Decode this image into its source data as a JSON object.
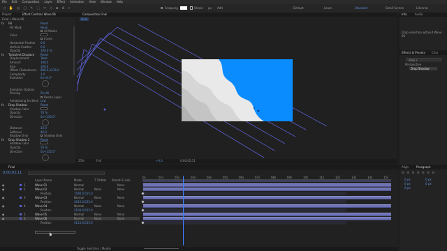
{
  "menu": [
    "File",
    "Edit",
    "Composition",
    "Layer",
    "Effect",
    "Animation",
    "View",
    "Window",
    "Help"
  ],
  "toolbar": {
    "snapping": "Snapping",
    "stroke_label": "Stroke",
    "px": "px",
    "add": "Add",
    "workspaces": [
      "Default",
      "Learn",
      "Standard",
      "Small Screen",
      "Libraries"
    ]
  },
  "project_tab": "Project",
  "effect_controls_tab": "Effect Controls Wave 06",
  "effect_subtitle": "Final • Wave 06",
  "effects": [
    {
      "type": "section",
      "label": "Fill",
      "right": "Reset"
    },
    {
      "type": "prop",
      "label": "Fill Mask",
      "value": "None"
    },
    {
      "type": "check",
      "label": "",
      "value": "All Masks"
    },
    {
      "type": "color",
      "label": "Color"
    },
    {
      "type": "check",
      "label": "",
      "value": "Invert"
    },
    {
      "type": "prop",
      "label": "Horizontal Feather",
      "value": "0.0"
    },
    {
      "type": "prop",
      "label": "Vertical Feather",
      "value": "0.0"
    },
    {
      "type": "prop",
      "label": "Opacity",
      "value": "100.0 %"
    },
    {
      "type": "section",
      "label": "Turbulent Displace",
      "right": "Reset"
    },
    {
      "type": "prop",
      "label": "Displacement",
      "value": "Twist"
    },
    {
      "type": "prop",
      "label": "Amount",
      "value": "100.0"
    },
    {
      "type": "prop",
      "label": "Size",
      "value": "100.0"
    },
    {
      "type": "prop",
      "label": "Offset (Turbulence)",
      "value": "896.0,1216.0"
    },
    {
      "type": "prop",
      "label": "Complexity",
      "value": "1.0"
    },
    {
      "type": "knob",
      "label": "Evolution",
      "value": "0x+0.0°"
    },
    {
      "type": "spacer"
    },
    {
      "type": "prop",
      "label": "Evolution Options",
      "value": ""
    },
    {
      "type": "prop",
      "label": "Pinning",
      "value": "Pin All"
    },
    {
      "type": "check",
      "label": "",
      "value": "Resize Layer"
    },
    {
      "type": "prop",
      "label": "Antialiasing for Best Qu",
      "value": "Low"
    },
    {
      "type": "section",
      "label": "Drop Shadow",
      "right": "Reset"
    },
    {
      "type": "color",
      "label": "Shadow Color"
    },
    {
      "type": "prop",
      "label": "Opacity",
      "value": "70 %"
    },
    {
      "type": "knob",
      "label": "Direction",
      "value": "0x+135.0°"
    },
    {
      "type": "spacer"
    },
    {
      "type": "prop",
      "label": "Distance",
      "value": "20.0"
    },
    {
      "type": "prop",
      "label": "Softness",
      "value": "40.0"
    },
    {
      "type": "check",
      "label": "Shadow Only",
      "value": "Shadow Only"
    },
    {
      "type": "section",
      "label": "Drop Shadow 2",
      "right": "Reset"
    },
    {
      "type": "color",
      "label": "Shadow Color"
    },
    {
      "type": "prop",
      "label": "Opacity",
      "value": "50 %"
    },
    {
      "type": "knob",
      "label": "Direction",
      "value": "0x+135.0°"
    }
  ],
  "comp": {
    "tab": "Composition Final",
    "chip": "Final",
    "zoom": "25%",
    "quality": "Full",
    "timecode": "0;00;02;11",
    "plus": "+0.0"
  },
  "info": {
    "tabs": [
      "Info",
      "Audio"
    ],
    "text": "Drop selection without Wave 06"
  },
  "effects_presets": {
    "title": "Effects & Presets",
    "tab2": "Char",
    "search": "drop s",
    "category": "Perspective",
    "item": "Drop Shadow"
  },
  "align": {
    "tab": "Align",
    "tab2": "Paragraph",
    "values": [
      "0 px",
      "0 px",
      "0 px",
      "0 px",
      "0 px"
    ]
  },
  "timeline": {
    "tab": "Final",
    "timecode": "0;00;02;11",
    "columns": [
      "Layer Name",
      "Mode",
      "T TrkMat",
      "Parent & Link"
    ],
    "ruler": [
      "0s",
      "01s",
      "02s",
      "03s",
      "04s",
      "05s",
      "06s",
      "07s",
      "08s",
      "09s",
      "10s",
      "11s",
      "12s",
      "13s",
      "14s",
      "15s"
    ],
    "footer": "Toggle Switches / Modes",
    "layers": [
      {
        "num": "1",
        "name": "Wave 01",
        "mode": "Normal",
        "trk": "",
        "parent": "None"
      },
      {
        "num": "2",
        "name": "Wave 02",
        "mode": "Normal",
        "trk": "None",
        "parent": "None"
      },
      {
        "num": "",
        "name": "Position",
        "mode": "1590.0,555.0",
        "trk": "",
        "parent": ""
      },
      {
        "num": "3",
        "name": "Wave 03",
        "mode": "Normal",
        "trk": "None",
        "parent": "None"
      },
      {
        "num": "",
        "name": "Position",
        "mode": "4015.0,555.0",
        "trk": "",
        "parent": ""
      },
      {
        "num": "4",
        "name": "Wave 04",
        "mode": "Normal",
        "trk": "None",
        "parent": "None"
      },
      {
        "num": "",
        "name": "Position",
        "mode": "2100.0,555.0",
        "trk": "",
        "parent": ""
      },
      {
        "num": "5",
        "name": "Wave 05",
        "mode": "Normal",
        "trk": "None",
        "parent": "None"
      },
      {
        "num": "6",
        "name": "Wave 06",
        "mode": "Normal",
        "trk": "None",
        "parent": "None"
      },
      {
        "num": "",
        "name": "Position",
        "mode": "4115.0,555.0",
        "trk": "",
        "parent": ""
      }
    ]
  }
}
